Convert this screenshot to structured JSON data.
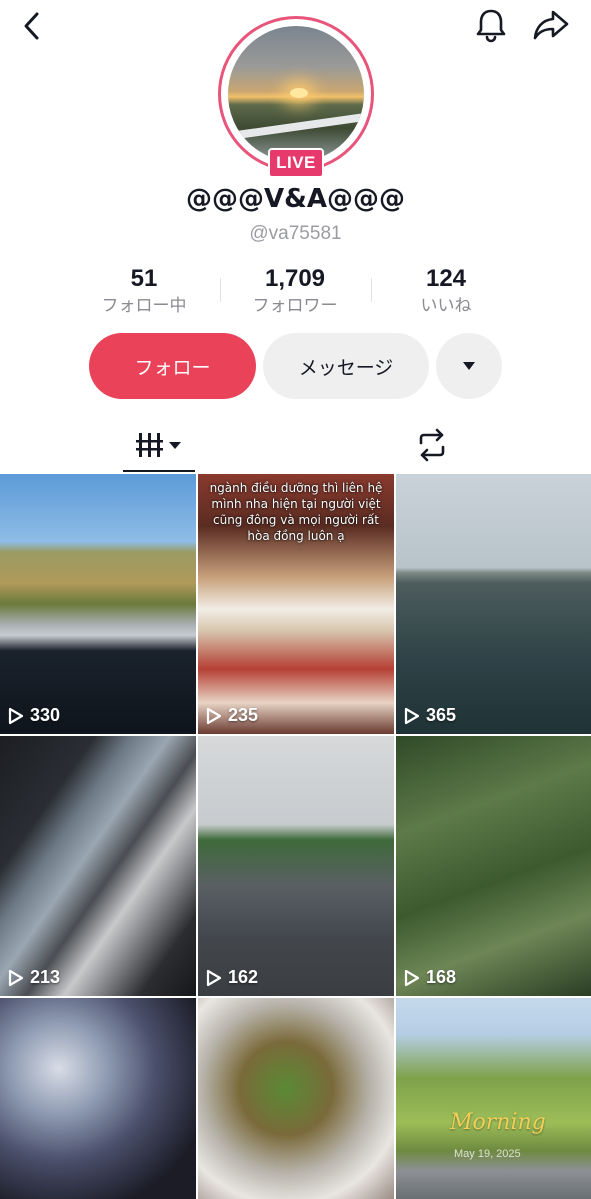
{
  "header": {
    "back_icon": "chevron-left-icon",
    "notification_icon": "bell-icon",
    "share_icon": "share-arrow-icon"
  },
  "profile": {
    "live_badge": "LIVE",
    "display_name": "@@@V&A@@@",
    "handle": "@va75581",
    "accent_color": "#e8547a"
  },
  "stats": [
    {
      "value": "51",
      "label": "フォロー中"
    },
    {
      "value": "1,709",
      "label": "フォロワー"
    },
    {
      "value": "124",
      "label": "いいね"
    }
  ],
  "actions": {
    "follow_label": "フォロー",
    "message_label": "メッセージ",
    "more_icon": "caret-down-icon",
    "follow_color": "#ea4359"
  },
  "tabs": {
    "videos_icon": "grid-bars-icon",
    "repost_icon": "repost-icon"
  },
  "videos": [
    {
      "views": "330"
    },
    {
      "views": "235",
      "caption": "ngành điều dưỡng thì liên hệ mình nha hiện tại người việt cũng đông và mọi người rất hòa đồng luôn ạ"
    },
    {
      "views": "365"
    },
    {
      "views": "213"
    },
    {
      "views": "162"
    },
    {
      "views": "168"
    },
    {
      "views": ""
    },
    {
      "views": ""
    },
    {
      "views": "",
      "watermark": "Morning",
      "date": "May 19, 2025"
    }
  ]
}
